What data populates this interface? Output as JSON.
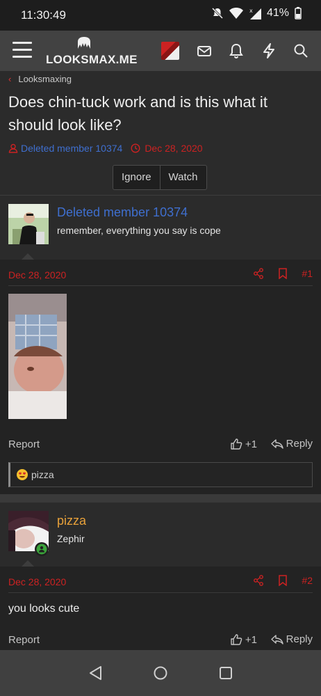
{
  "status_bar": {
    "time": "11:30:49",
    "battery": "41%"
  },
  "header": {
    "logo_text": "LOOKSMAX.ME",
    "icons": [
      "menu-icon",
      "user-avatar",
      "mail-icon",
      "bell-icon",
      "bolt-icon",
      "search-icon"
    ]
  },
  "thread": {
    "breadcrumb": "Looksmaxing",
    "title": "Does chin-tuck work and is this what it should look like?",
    "author": "Deleted member 10374",
    "date": "Dec 28, 2020",
    "ignore_label": "Ignore",
    "watch_label": "Watch"
  },
  "posts": [
    {
      "username": "Deleted member 10374",
      "user_title": "remember, everything you say is cope",
      "date": "Dec 28, 2020",
      "number": "#1",
      "report_label": "Report",
      "like_count": "+1",
      "reply_label": "Reply",
      "reaction_user": "pizza"
    },
    {
      "username": "pizza",
      "user_title": "Zephir",
      "date": "Dec 28, 2020",
      "number": "#2",
      "content": "you looks cute",
      "report_label": "Report",
      "like_count": "+1",
      "reply_label": "Reply"
    }
  ],
  "colors": {
    "accent_red": "#cc2222",
    "author_blue": "#3f6fcf",
    "username_orange": "#e8a13a"
  }
}
